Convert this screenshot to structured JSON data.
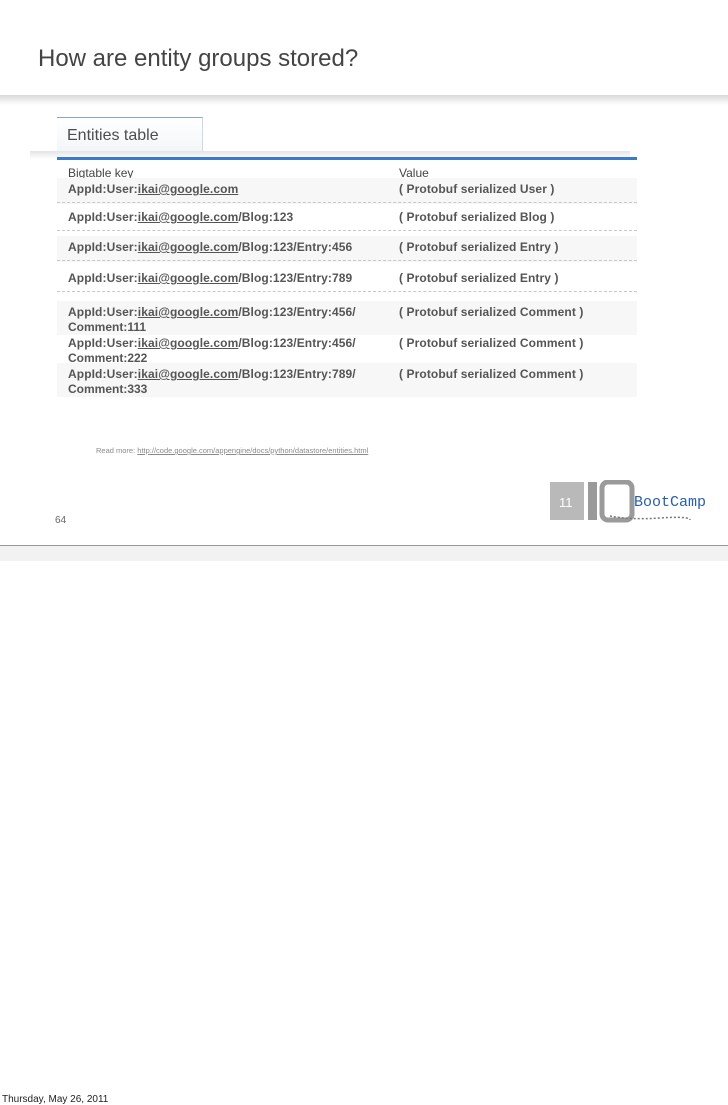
{
  "slide": {
    "title": "How are entity groups stored?",
    "tab_label": "Entities table",
    "page_number": "64",
    "footer_date": "Thursday, May 26, 2011"
  },
  "table": {
    "headers": {
      "key": "Bigtable key",
      "value": "Value"
    },
    "rows": [
      {
        "key_prefix": "AppId:User:",
        "email": "ikai@google.com",
        "key_suffix": "",
        "key_line2": "",
        "value": "( Protobuf serialized User )"
      },
      {
        "key_prefix": "AppId:User:",
        "email": "ikai@google.com",
        "key_suffix": "/Blog:123",
        "key_line2": "",
        "value": "( Protobuf serialized Blog )"
      },
      {
        "key_prefix": "AppId:User:",
        "email": "ikai@google.com",
        "key_suffix": "/Blog:123/Entry:456",
        "key_line2": "",
        "value": "( Protobuf serialized Entry )"
      },
      {
        "key_prefix": "AppId:User:",
        "email": "ikai@google.com",
        "key_suffix": "/Blog:123/Entry:789",
        "key_line2": "",
        "value": "( Protobuf serialized Entry )"
      },
      {
        "key_prefix": "AppId:User:",
        "email": "ikai@google.com",
        "key_suffix": "/Blog:123/Entry:456/",
        "key_line2": "Comment:111",
        "value": "( Protobuf serialized Comment )"
      },
      {
        "key_prefix": "AppId:User:",
        "email": "ikai@google.com",
        "key_suffix": "/Blog:123/Entry:456/",
        "key_line2": "Comment:222",
        "value": "( Protobuf serialized Comment )"
      },
      {
        "key_prefix": "AppId:User:",
        "email": "ikai@google.com",
        "key_suffix": "/Blog:123/Entry:789/",
        "key_line2": "Comment:333",
        "value": "( Protobuf serialized Comment )"
      }
    ]
  },
  "read_more": {
    "label": "Read more: ",
    "url": "http://code.google.com/appengine/docs/python/datastore/entities.html"
  },
  "logo": {
    "number": "11",
    "text": "BootCamp",
    "icon": "io-bootcamp-logo"
  },
  "colors": {
    "accent_blue": "#3b78c9",
    "logo_blue": "#2a5fa8"
  }
}
